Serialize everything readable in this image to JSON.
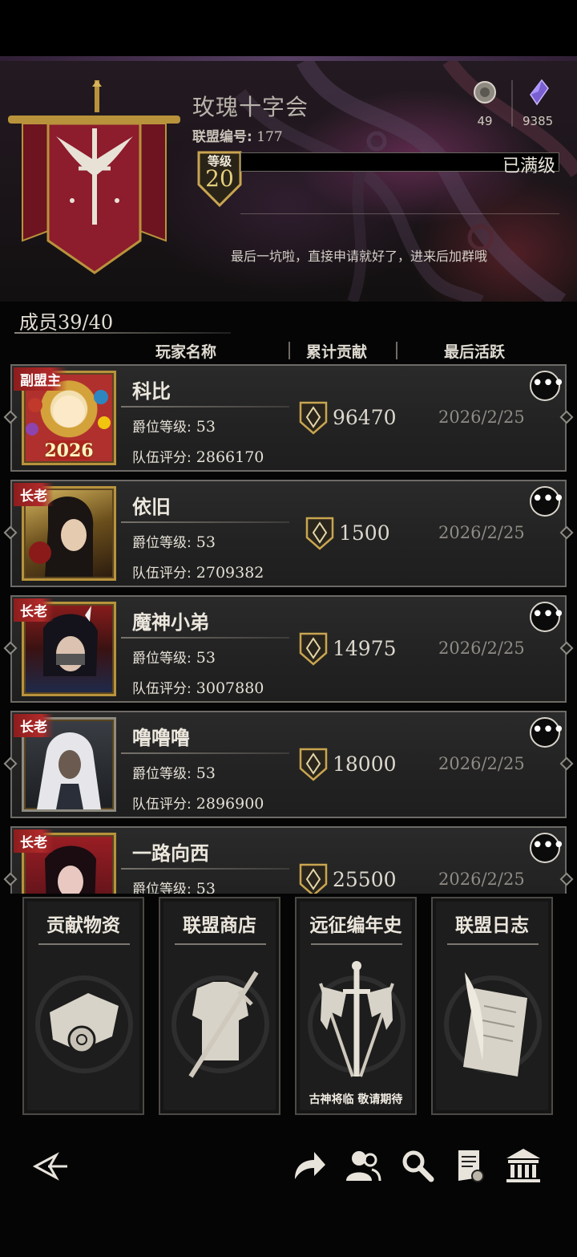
{
  "header": {
    "guild_name": "玫瑰十字会",
    "guild_id_label": "联盟编号:",
    "guild_id": "177",
    "currencies": [
      {
        "icon": "silver-coin-icon",
        "value": "49"
      },
      {
        "icon": "purple-crystal-icon",
        "value": "9385"
      }
    ],
    "level_label": "等级",
    "level": "20",
    "level_status": "已满级",
    "motto": "最后一坑啦，直接申请就好了，进来后加群哦"
  },
  "members": {
    "title": "成员39/40",
    "columns": [
      "玩家名称",
      "累计贡献",
      "最后活跃"
    ],
    "rank_label": "爵位等级:",
    "score_label": "队伍评分:",
    "rows": [
      {
        "role": "副盟主",
        "name": "科比",
        "rank": "53",
        "score": "2866170",
        "contribution": "96470",
        "last_active": "2026/2/25",
        "avatar_caption": "2026"
      },
      {
        "role": "长老",
        "name": "依旧",
        "rank": "53",
        "score": "2709382",
        "contribution": "1500",
        "last_active": "2026/2/25"
      },
      {
        "role": "长老",
        "name": "魔神小弟",
        "rank": "53",
        "score": "3007880",
        "contribution": "14975",
        "last_active": "2026/2/25"
      },
      {
        "role": "长老",
        "name": "噜噜噜",
        "rank": "53",
        "score": "2896900",
        "contribution": "18000",
        "last_active": "2026/2/25"
      },
      {
        "role": "长老",
        "name": "一路向西",
        "rank": "53",
        "score": "",
        "contribution": "25500",
        "last_active": "2026/2/25"
      }
    ]
  },
  "functions": [
    {
      "title": "贡献物资",
      "note": ""
    },
    {
      "title": "联盟商店",
      "note": ""
    },
    {
      "title": "远征编年史",
      "note": "古神将临 敬请期待"
    },
    {
      "title": "联盟日志",
      "note": ""
    }
  ],
  "more_symbol": "•••",
  "colors": {
    "accent_gold": "#b8933c",
    "role_red": "#a82626",
    "banner_red": "#8d1c2c"
  }
}
